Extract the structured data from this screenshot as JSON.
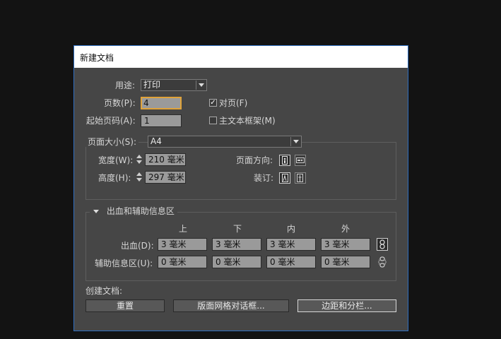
{
  "dialog": {
    "title": "新建文档",
    "intent_label": "用途:",
    "intent_value": "打印",
    "pages_label": "页数(P):",
    "pages_value": "4",
    "facing_label": "对页(F)",
    "facing_checked": true,
    "start_label": "起始页码(A):",
    "start_value": "1",
    "master_frame_label": "主文本框架(M)",
    "master_frame_checked": false,
    "page_size": {
      "label": "页面大小(S):",
      "value": "A4",
      "width_label": "宽度(W):",
      "width_value": "210 毫米",
      "height_label": "高度(H):",
      "height_value": "297 毫米",
      "orientation_label": "页面方向:",
      "binding_label": "装订:"
    },
    "bleed": {
      "section_label": "出血和辅助信息区",
      "col_top": "上",
      "col_bottom": "下",
      "col_inside": "内",
      "col_outside": "外",
      "bleed_label": "出血(D):",
      "bleed_values": [
        "3 毫米",
        "3 毫米",
        "3 毫米",
        "3 毫米"
      ],
      "slug_label": "辅助信息区(U):",
      "slug_values": [
        "0 毫米",
        "0 毫米",
        "0 毫米",
        "0 毫米"
      ]
    },
    "create_label": "创建文档:",
    "buttons": {
      "reset": "重置",
      "layout_grid": "版面网格对话框...",
      "margins_columns": "边距和分栏..."
    },
    "colors": {
      "accent_border": "#2f6fc1",
      "focus": "#e0a33a",
      "panel": "#464646"
    }
  }
}
